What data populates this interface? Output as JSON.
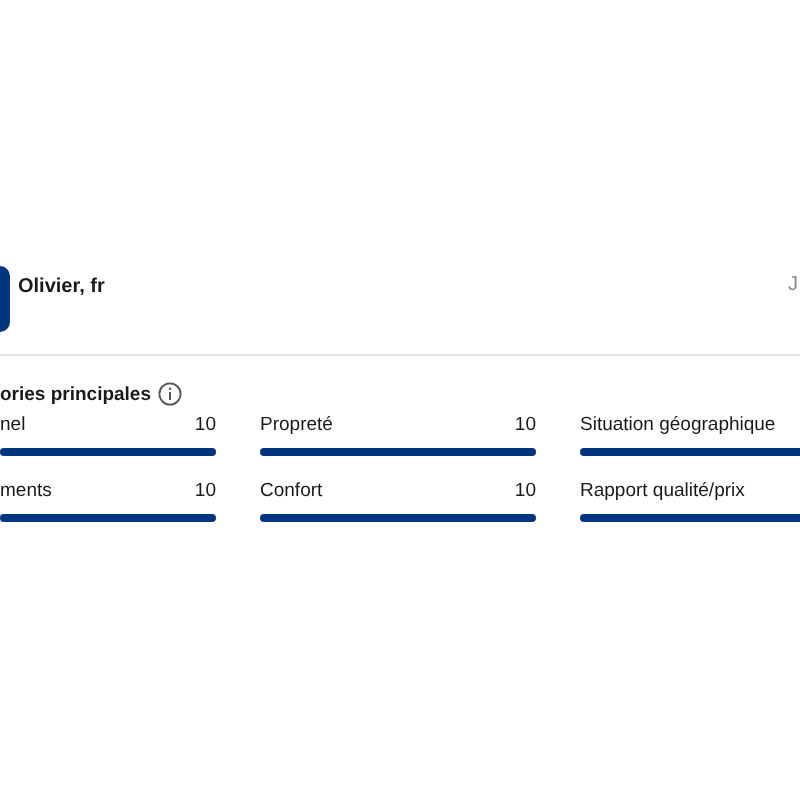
{
  "review": {
    "reviewer": "Olivier, fr",
    "date_fragment": "J"
  },
  "categories": {
    "title": "ories principales",
    "items": [
      {
        "label": "nel",
        "score": "10",
        "level": 1
      },
      {
        "label": "Propreté",
        "score": "10",
        "level": 1
      },
      {
        "label": "Situation géographique",
        "level": 1
      },
      {
        "label": "ments",
        "score": "10",
        "level": 1
      },
      {
        "label": "Confort",
        "score": "10",
        "level": 1
      },
      {
        "label": "Rapport qualité/prix",
        "level": 1
      }
    ]
  }
}
